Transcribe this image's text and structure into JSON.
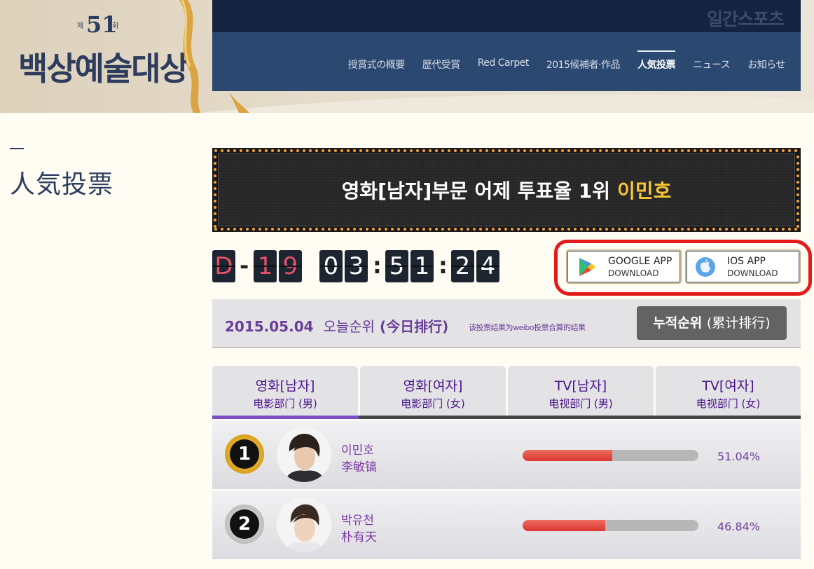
{
  "header": {
    "logo": {
      "badge_prefix": "제",
      "badge_number": "51",
      "badge_suffix": "회",
      "title": "백상예술대상"
    },
    "brand": "일간스포츠",
    "nav": [
      {
        "label": "授賞式の概要"
      },
      {
        "label": "歴代受賞"
      },
      {
        "label": "Red Carpet"
      },
      {
        "label": "2015候補者·作品"
      },
      {
        "label": "人気投票",
        "active": true
      },
      {
        "label": "ニュース"
      },
      {
        "label": "お知らせ"
      }
    ]
  },
  "sidebar": {
    "title": "人気投票"
  },
  "banner": {
    "text": "영화[남자]부문 어제 투표율 1위",
    "highlight": "이민호"
  },
  "countdown": {
    "d_label": "D",
    "dash": "-",
    "days": [
      "1",
      "9"
    ],
    "hours": [
      "0",
      "3"
    ],
    "minutes": [
      "5",
      "1"
    ],
    "seconds": [
      "2",
      "4"
    ],
    "colon": ":"
  },
  "apps": {
    "google": {
      "line1": "GOOGLE APP",
      "line2": "DOWNLOAD",
      "icon": "google-play-icon"
    },
    "ios": {
      "line1": "IOS APP",
      "line2": "DOWNLOAD",
      "icon": "apple-icon"
    }
  },
  "ranking_header": {
    "date": "2015.05.04",
    "label": "오늘순위",
    "label_cn": "(今日排行)",
    "note": "该投票结果为weibo投票合算的结果",
    "cumulative_label": "누적순위",
    "cumulative_cn": "(累计排行)"
  },
  "tabs": [
    {
      "ko": "영화[남자]",
      "cn": "电影部门 (男)",
      "active": true
    },
    {
      "ko": "영화[여자]",
      "cn": "电影部门 (女)"
    },
    {
      "ko": "TV[남자]",
      "cn": "电视部门 (男)"
    },
    {
      "ko": "TV[여자]",
      "cn": "电视部门 (女)"
    }
  ],
  "rankings": [
    {
      "rank": "1",
      "name_ko": "이민호",
      "name_cn": "李敏镐",
      "percent_label": "51.04%",
      "percent": 51.04,
      "medal": "gold"
    },
    {
      "rank": "2",
      "name_ko": "박유천",
      "name_cn": "朴有天",
      "percent_label": "46.84%",
      "percent": 46.84,
      "medal": "silver"
    }
  ],
  "colors": {
    "accent_purple": "#6a3d9a",
    "banner_highlight": "#f8c537",
    "nav_bg": "#2b4870",
    "bar_fill": "#e24a40",
    "annotation_red": "#e41a1a"
  }
}
